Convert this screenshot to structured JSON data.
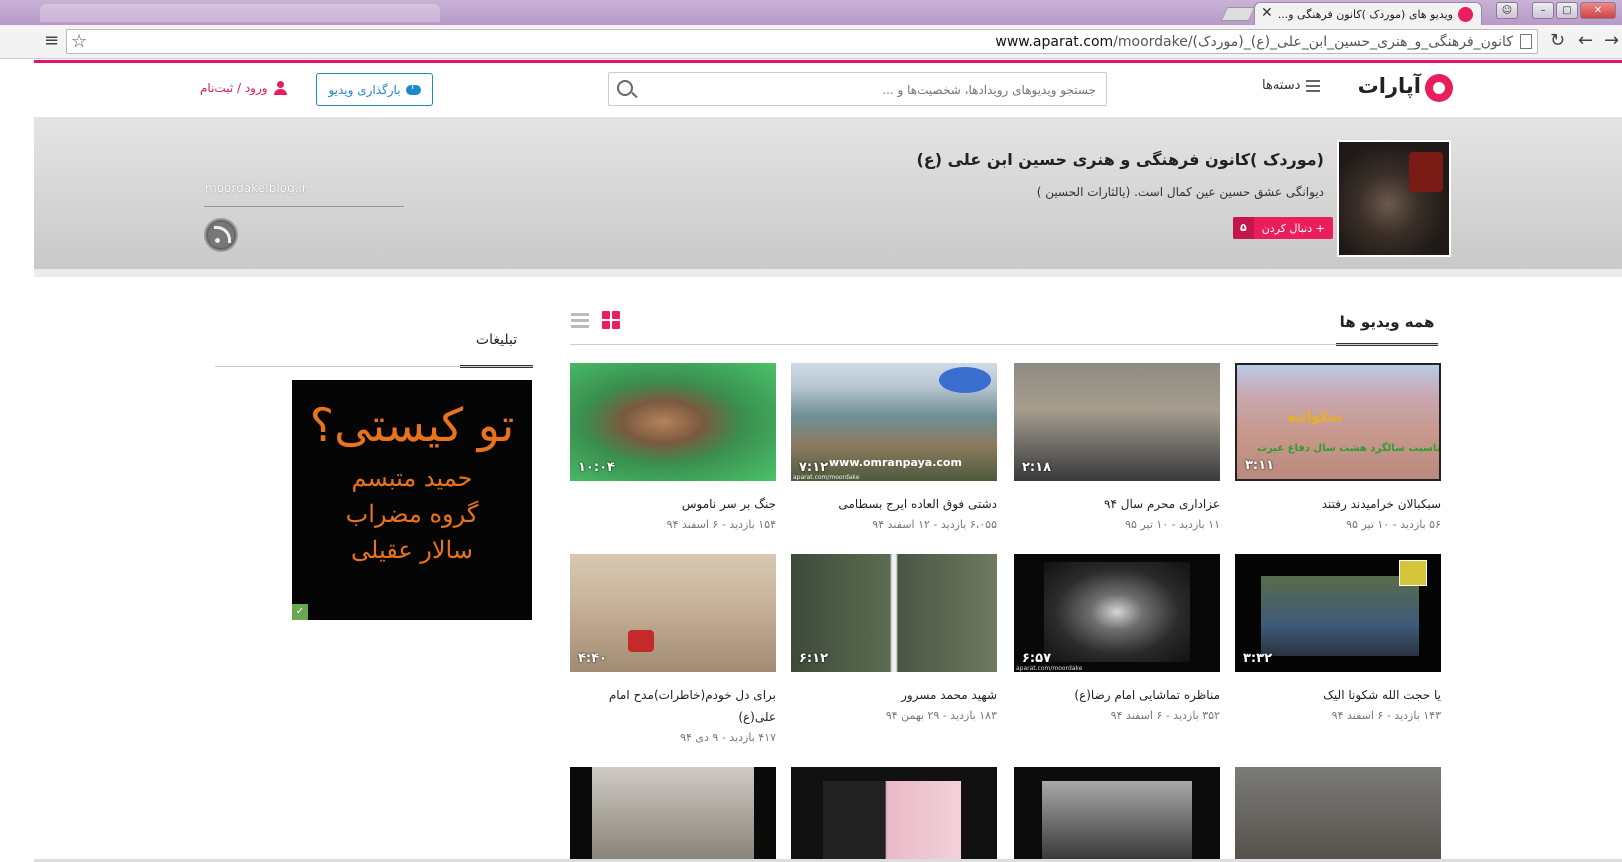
{
  "browser": {
    "tab_title": "ویدیو های (موردک )کانون فرهنگی و...",
    "tab_close": "✕",
    "url_domain": "www.aparat.com",
    "url_path": "/moordake/(موردک)_کانون_فرهنگی_و_هنری_حسین_ابن_علی_(ع)",
    "min": "–",
    "max": "□",
    "close": "✕"
  },
  "header": {
    "logo_text": "آپارات",
    "categories_label": "دسته‌ها",
    "search_placeholder": "جستجو ویدیوهای رویدادها، شخصیت‌ها و ...",
    "upload_label": "بارگذاری ویدیو",
    "login_label": "ورود / ثبت‌نام"
  },
  "channel": {
    "name": "(موردک )کانون فرهنگی و هنری حسین ابن علی (ع)",
    "description": "دیوانگی عشق حسین عین کمال است. (یالثارات الحسین )",
    "follow_label": "+ دنبال کردن",
    "follow_count": "۵",
    "link": "moordake.blog.ir"
  },
  "section": {
    "all_videos": "همه ویدیو ها",
    "ads": "تبلیغات"
  },
  "ad": {
    "line1": "تو کیستی؟",
    "line2": "حمید متبسم",
    "line3": "گروه مضراب",
    "line4": "سالار عقیلی"
  },
  "colors": {
    "brand": "#ea1d5d",
    "link": "#1e88c8"
  },
  "videos": [
    {
      "title": "سبکبالان خرامیدند رفتند",
      "meta": "۵۶ بازدید  -  ۱۰ تیر ۹۵",
      "duration": "۳:۱۱"
    },
    {
      "title": "عزاداری محرم سال ۹۴",
      "meta": "۱۱ بازدید  -  ۱۰ تیر ۹۵",
      "duration": "۲:۱۸"
    },
    {
      "title": "دشتی فوق العاده ایرج بسطامی",
      "meta": "۶،۰۵۵ بازدید  -  ۱۲ اسفند ۹۴",
      "duration": "۷:۱۲"
    },
    {
      "title": "جنگ بر سر ناموس",
      "meta": "۱۵۴ بازدید  -  ۶ اسفند ۹۴",
      "duration": "۱۰:۰۴"
    },
    {
      "title": "یا حجت الله شکونا الیک",
      "meta": "۱۴۳ بازدید  -  ۶ اسفند ۹۴",
      "duration": "۳:۳۲"
    },
    {
      "title": "مناظره تماشایی امام رضا(ع)",
      "meta": "۳۵۲ بازدید  -  ۶ اسفند ۹۴",
      "duration": "۶:۵۷"
    },
    {
      "title": "شهید محمد مسرور",
      "meta": "۱۸۳ بازدید  -  ۲۹ بهمن ۹۴",
      "duration": "۶:۱۲"
    },
    {
      "title": "برای دل خودم(خاطرات)مدح امام علی(ع)",
      "meta": "۴۱۷ بازدید  -  ۹ دی ۹۴",
      "duration": "۴:۴۰"
    }
  ],
  "watermark": {
    "v1_title": "شکوائیه",
    "v1_sub": "بمناسبت سالگرد هشت سال دفاع غیرت",
    "v3_site": "www.omranpaya.com",
    "v3_small": "aparat.com/moordake",
    "v6_small": "aparat.com/moordake"
  }
}
